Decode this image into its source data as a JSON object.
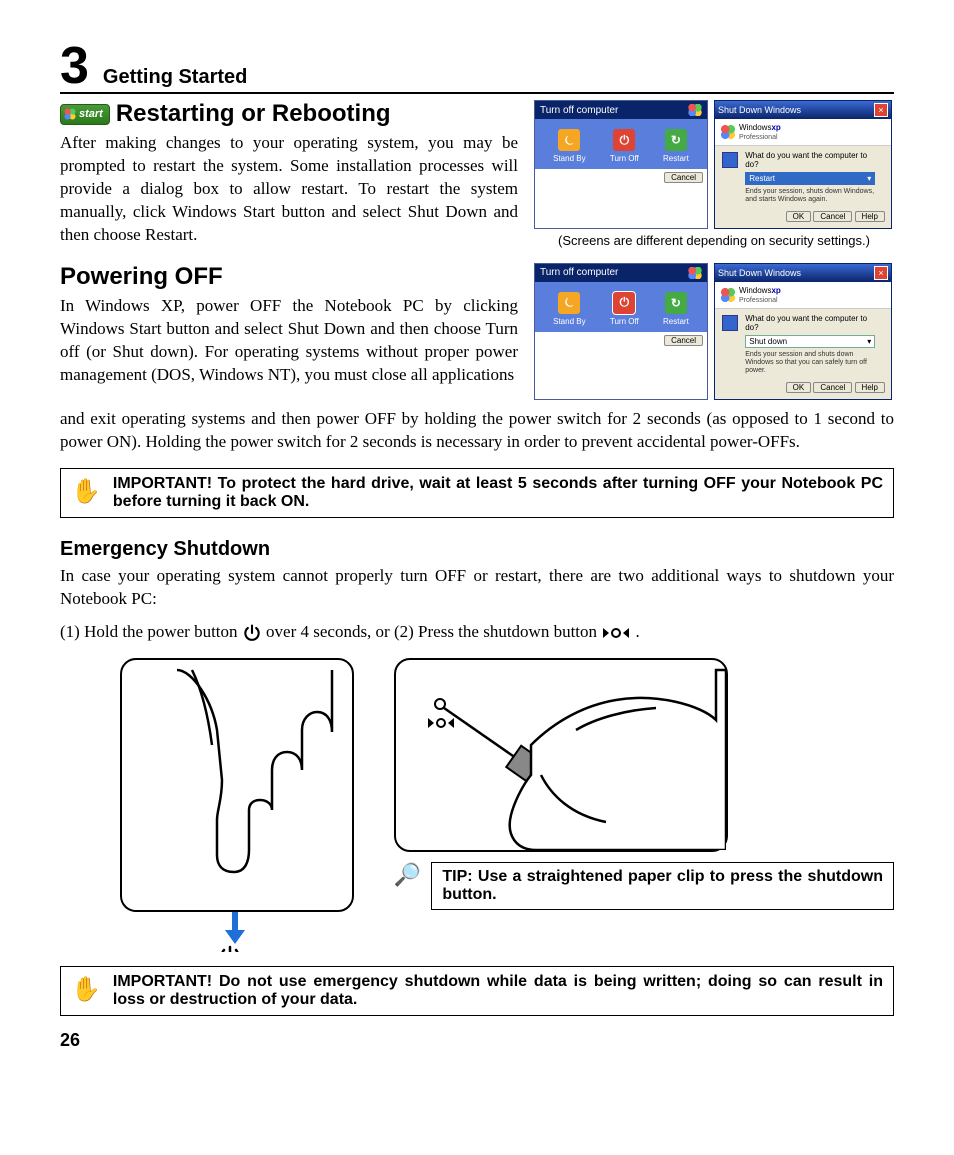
{
  "chapter": {
    "number": "3",
    "title": "Getting Started"
  },
  "start_badge": "start",
  "restarting": {
    "heading": "Restarting or Rebooting",
    "body": "After making changes to your operating system, you may be prompted to restart the system. Some installation processes will provide a dialog box to allow restart. To restart the system manually, click Windows Start button and select Shut Down and then choose Restart."
  },
  "screenshots_caption": "(Screens are different depending on security settings.)",
  "turn_off_dialog": {
    "title": "Turn off computer",
    "standby": "Stand By",
    "turnoff": "Turn Off",
    "restart": "Restart",
    "cancel": "Cancel"
  },
  "shutdown_dialog": {
    "title": "Shut Down Windows",
    "brand": "Windows",
    "brand_suffix": "xp",
    "brand_sub": "Professional",
    "prompt": "What do you want the computer to do?",
    "option_restart": "Restart",
    "desc_restart": "Ends your session, shuts down Windows, and starts Windows again.",
    "option_shutdown": "Shut down",
    "desc_shutdown": "Ends your session and shuts down Windows so that you can safely turn off power.",
    "ok": "OK",
    "cancel": "Cancel",
    "help": "Help"
  },
  "powering_off": {
    "heading": "Powering OFF",
    "body1": "In Windows XP, power OFF the Notebook PC by clicking Windows Start button and select Shut Down and then choose Turn off (or Shut down). For operating systems without proper power management (DOS, Windows NT), you must close all applications",
    "body2": "and exit operating systems and then power OFF by holding the power switch for 2 seconds (as opposed to 1 second to power ON). Holding the power switch for 2 seconds is necessary in order to prevent accidental power-OFFs."
  },
  "important1": "IMPORTANT!  To protect the hard drive, wait at least 5 seconds after turning OFF your Notebook PC before turning it back ON.",
  "emergency": {
    "heading": "Emergency Shutdown",
    "intro": "In case your operating system cannot properly turn OFF or restart, there are two additional ways to shutdown your Notebook PC:",
    "step1a": "(1) Hold the power button ",
    "step1b": " over 4 seconds, or  (2) Press the shutdown button ",
    "step1c": "."
  },
  "tip": "TIP: Use a straightened paper clip to press the shutdown button.",
  "important2": "IMPORTANT!  Do not use emergency shutdown while data is being written; doing so can result in loss or destruction of your data.",
  "page_number": "26"
}
